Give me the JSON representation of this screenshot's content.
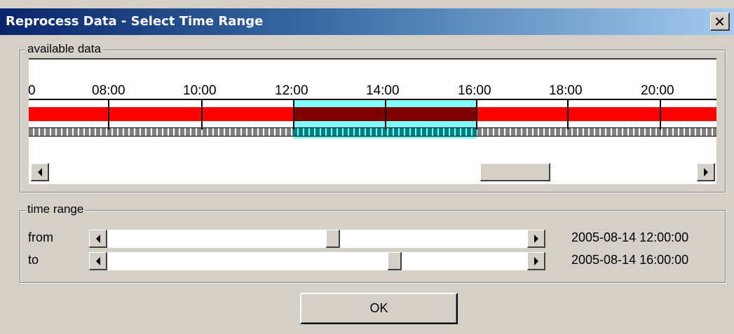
{
  "window": {
    "title": "Reprocess Data - Select Time Range",
    "close_symbol": "✕"
  },
  "available_data": {
    "legend": "available data",
    "time_ticks": [
      "0",
      "08:00",
      "10:00",
      "12:00",
      "14:00",
      "16:00",
      "18:00",
      "20:00"
    ],
    "selection": {
      "from": "12:00",
      "to": "16:00"
    },
    "colors": {
      "data_bar": "#ff0000",
      "data_bar_selected": "#800000",
      "selection_highlight": "#80ffff",
      "segments": "#808080",
      "segments_selected": "#008080"
    },
    "scroll_position_fraction": 0.66
  },
  "time_range": {
    "legend": "time range",
    "from_label": "from",
    "to_label": "to",
    "from_value": "2005-08-14 12:00:00",
    "to_value": "2005-08-14 16:00:00",
    "from_slider_fraction": 0.53,
    "to_slider_fraction": 0.68
  },
  "buttons": {
    "ok_label": "OK"
  },
  "icons": {
    "scroll_left": "scroll-left-arrow-icon",
    "scroll_right": "scroll-right-arrow-icon"
  }
}
